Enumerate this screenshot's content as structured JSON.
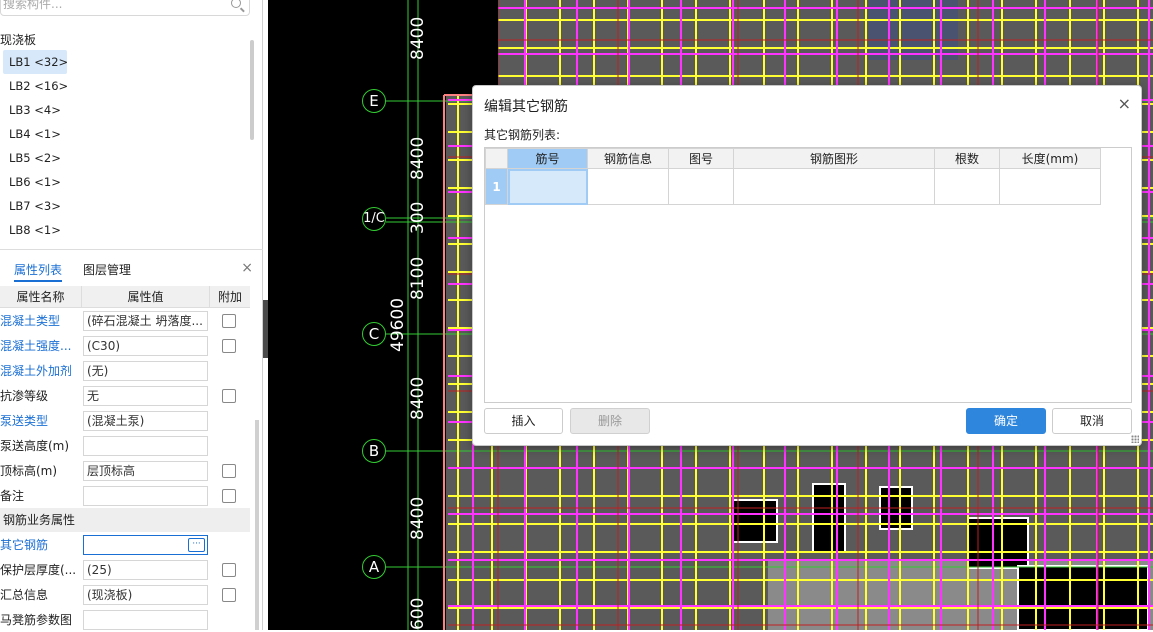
{
  "left_panel": {
    "search_placeholder": "搜索构件...",
    "group_label": "现浇板",
    "components": [
      {
        "label": "LB1 <32>",
        "selected": true
      },
      {
        "label": "LB2 <16>"
      },
      {
        "label": "LB3 <4>"
      },
      {
        "label": "LB4 <1>"
      },
      {
        "label": "LB5 <2>"
      },
      {
        "label": "LB6 <1>"
      },
      {
        "label": "LB7 <3>"
      },
      {
        "label": "LB8 <1>"
      }
    ],
    "tabs": {
      "properties": "属性列表",
      "layers": "图层管理",
      "close": "×"
    },
    "prop_headers": {
      "name": "属性名称",
      "value": "属性值",
      "attach": "附加"
    },
    "props": [
      {
        "name": "混凝土类型",
        "value": "(碎石混凝土 坍落度...",
        "link": true,
        "check": true
      },
      {
        "name": "混凝土强度...",
        "value": "(C30)",
        "link": true,
        "check": true
      },
      {
        "name": "混凝土外加剂",
        "value": "(无)",
        "link": true,
        "check": false
      },
      {
        "name": "抗渗等级",
        "value": "无",
        "link": false,
        "check": true
      },
      {
        "name": "泵送类型",
        "value": "(混凝土泵)",
        "link": true,
        "check": false
      },
      {
        "name": "泵送高度(m)",
        "value": "",
        "link": false,
        "check": false
      },
      {
        "name": "顶标高(m)",
        "value": "层顶标高",
        "link": false,
        "check": true
      },
      {
        "name": "备注",
        "value": "",
        "link": false,
        "check": true
      }
    ],
    "group2_label": "钢筋业务属性",
    "props2": [
      {
        "name": "其它钢筋",
        "value": "",
        "link": true,
        "check": false,
        "active": true
      },
      {
        "name": "保护层厚度(...",
        "value": "(25)",
        "link": false,
        "check": true
      },
      {
        "name": "汇总信息",
        "value": "(现浇板)",
        "link": false,
        "check": true
      },
      {
        "name": "马凳筋参数图",
        "value": "",
        "link": false,
        "check": false
      }
    ],
    "ellipsis": "···",
    "collapse": "‹"
  },
  "canvas": {
    "axis_dims": [
      "8400",
      "8400",
      "300",
      "8100",
      "8400",
      "8400",
      "600"
    ],
    "total_dim": "49600",
    "axis_labels": [
      "E",
      "1/C",
      "C",
      "B",
      "A"
    ]
  },
  "dialog": {
    "title": "编辑其它钢筋",
    "close": "×",
    "list_label": "其它钢筋列表:",
    "columns": [
      "筋号",
      "钢筋信息",
      "图号",
      "钢筋图形",
      "根数",
      "长度(mm)"
    ],
    "rows": [
      {
        "num": "1",
        "cells": [
          "",
          "",
          "",
          "",
          "",
          ""
        ]
      }
    ],
    "buttons": {
      "insert": "插入",
      "delete": "删除",
      "ok": "确定",
      "cancel": "取消"
    }
  },
  "colors": {
    "accent": "#1a6fd4",
    "primary_button": "#2f86dd",
    "grid_select": "#9fcbf4",
    "cad_yellow": "#ffff33",
    "cad_magenta": "#ff33ff"
  }
}
